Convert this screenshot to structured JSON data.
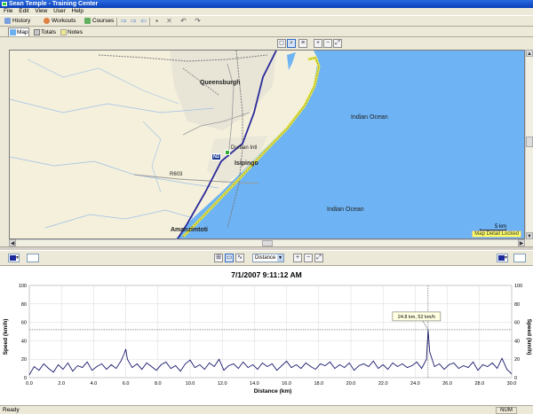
{
  "window": {
    "title": "Sean Temple - Training Center"
  },
  "menu": [
    "File",
    "Edit",
    "View",
    "User",
    "Help"
  ],
  "toolbar": {
    "history_label": "History",
    "workouts_label": "Workouts",
    "courses_label": "Courses"
  },
  "view_tabs": [
    "Map",
    "Totals",
    "Notes"
  ],
  "map": {
    "labels": {
      "queensburgh": "Queensburgh",
      "indian_ocean_1": "Indian Ocean",
      "indian_ocean_2": "Indian Ocean",
      "isipingo": "Isipingo",
      "durban_intl": "Durban Intl",
      "r603": "R603",
      "amanzimtoti": "Amanzimtoti",
      "n2": "N2"
    },
    "scale_label": "5 km",
    "detail_lock_label": "Map Detail Locked",
    "colors": {
      "land": "#f4f0dc",
      "sea": "#6eb3f4",
      "highway": "#2a2a9a",
      "route": "#e8e840",
      "rail": "#888888"
    }
  },
  "chart_toolbar": {
    "x_axis_option": "Distance",
    "left_color": "#1a2a9a",
    "right_color": "#1a2a9a"
  },
  "chart_data": {
    "type": "line",
    "title": "7/1/2007 9:11:12 AM",
    "xlabel": "Distance (km)",
    "ylabel": "Speed (km/h)",
    "ylabel_right": "Speed (km/h)",
    "xlim": [
      0,
      30
    ],
    "ylim": [
      0,
      100
    ],
    "x_ticks": [
      "0.0",
      "2.0",
      "4.0",
      "6.0",
      "8.0",
      "10.0",
      "12.0",
      "14.0",
      "16.0",
      "18.0",
      "20.0",
      "22.0",
      "24.0",
      "26.0",
      "28.0",
      "30.0"
    ],
    "y_ticks": [
      "0",
      "20",
      "40",
      "60",
      "80",
      "100"
    ],
    "tooltip": {
      "text": "24.8 km, 52 km/h",
      "x": 24.8,
      "y": 52
    },
    "series": [
      {
        "color": "#1a1a6e",
        "x": [
          0.0,
          0.3,
          0.6,
          0.9,
          1.2,
          1.5,
          1.8,
          2.1,
          2.4,
          2.7,
          3.0,
          3.3,
          3.6,
          3.9,
          4.2,
          4.5,
          4.8,
          5.1,
          5.4,
          5.7,
          5.9,
          6.0,
          6.1,
          6.4,
          6.7,
          7.0,
          7.3,
          7.6,
          7.9,
          8.2,
          8.5,
          8.8,
          9.1,
          9.4,
          9.7,
          10.0,
          10.3,
          10.6,
          10.9,
          11.2,
          11.5,
          11.8,
          12.1,
          12.4,
          12.7,
          13.0,
          13.3,
          13.6,
          13.9,
          14.2,
          14.5,
          14.8,
          15.1,
          15.4,
          15.7,
          16.0,
          16.3,
          16.6,
          16.9,
          17.2,
          17.5,
          17.8,
          18.1,
          18.4,
          18.7,
          19.0,
          19.3,
          19.6,
          19.9,
          20.2,
          20.5,
          20.8,
          21.1,
          21.4,
          21.7,
          22.0,
          22.3,
          22.6,
          22.9,
          23.2,
          23.5,
          23.8,
          24.1,
          24.4,
          24.7,
          24.8,
          24.9,
          25.2,
          25.5,
          25.8,
          26.1,
          26.4,
          26.7,
          27.0,
          27.3,
          27.6,
          27.9,
          28.2,
          28.5,
          28.8,
          29.1,
          29.4,
          29.7,
          30.0
        ],
        "y": [
          3,
          12,
          8,
          15,
          10,
          6,
          14,
          9,
          16,
          7,
          13,
          11,
          17,
          8,
          12,
          15,
          9,
          14,
          10,
          18,
          26,
          31,
          20,
          11,
          15,
          9,
          16,
          12,
          8,
          14,
          17,
          10,
          13,
          7,
          15,
          19,
          11,
          14,
          9,
          16,
          12,
          20,
          8,
          13,
          15,
          10,
          17,
          11,
          14,
          9,
          16,
          12,
          15,
          8,
          13,
          18,
          11,
          14,
          10,
          16,
          12,
          9,
          15,
          13,
          17,
          10,
          14,
          11,
          16,
          8,
          13,
          15,
          12,
          18,
          10,
          14,
          9,
          16,
          12,
          15,
          11,
          13,
          17,
          10,
          20,
          52,
          28,
          12,
          15,
          9,
          14,
          16,
          10,
          13,
          11,
          17,
          8,
          14,
          12,
          16,
          10,
          21,
          9,
          4
        ]
      }
    ]
  },
  "status": {
    "text": "Ready",
    "num": "NUM"
  }
}
